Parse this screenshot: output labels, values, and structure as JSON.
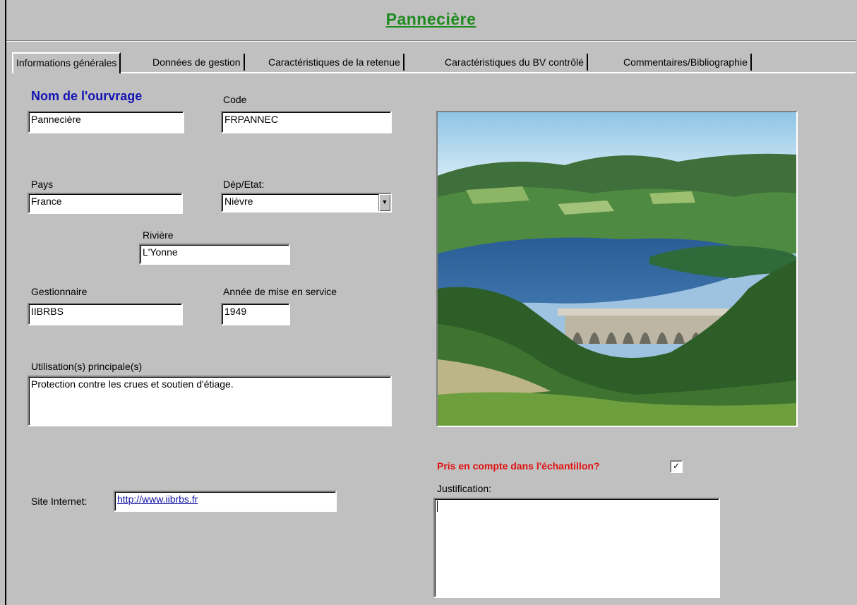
{
  "header": {
    "title": "Pannecière"
  },
  "tabs": [
    {
      "label": "Informations générales",
      "active": true
    },
    {
      "label": "Données de gestion"
    },
    {
      "label": "Caractéristiques de la retenue"
    },
    {
      "label": "Caractéristiques du BV contrôlé"
    },
    {
      "label": "Commentaires/Bibliographie"
    }
  ],
  "form": {
    "nom_label": "Nom de l'ourvrage",
    "nom_value": "Pannecière",
    "code_label": "Code",
    "code_value": "FRPANNEC",
    "pays_label": "Pays",
    "pays_value": "France",
    "dep_label": "Dép/Etat:",
    "dep_value": "Nièvre",
    "riviere_label": "Rivière",
    "riviere_value": "L'Yonne",
    "gestionnaire_label": "Gestionnaire",
    "gestionnaire_value": "IIBRBS",
    "annee_label": "Année de mise en service",
    "annee_value": "1949",
    "utilisation_label": "Utilisation(s) principale(s)",
    "utilisation_value": "Protection contre les crues et soutien d'étiage.",
    "site_label": "Site Internet:",
    "site_value": "http://www.iibrbs.fr",
    "pris_label": "Pris en compte dans l'échantillon?",
    "pris_checked": true,
    "justification_label": "Justification:",
    "justification_value": ""
  },
  "photo": {
    "icon": "dam-photo"
  },
  "colors": {
    "title": "#1f8a1f",
    "blue_heading": "#1414b4",
    "red_heading": "#e01010",
    "window_bg": "#c0c0c0"
  }
}
